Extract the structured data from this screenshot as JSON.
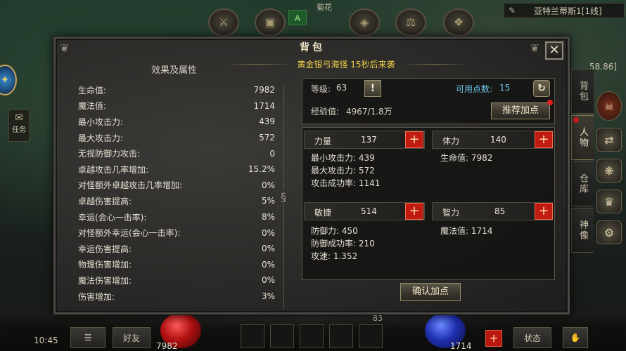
{
  "hud": {
    "top_label": "菊花",
    "top_badge": "A",
    "server_name": "亚特兰蒂斯1[1线]",
    "coord": "58.86]",
    "task_label": "任务",
    "time": "10:45",
    "friend_label": "好友",
    "hp_number": "7982",
    "mp_number": "1714",
    "level_small": "83",
    "state_label": "状态"
  },
  "side_tabs": [
    {
      "label": "背包"
    },
    {
      "label": "人物"
    },
    {
      "label": "仓库"
    },
    {
      "label": "神像"
    }
  ],
  "panel": {
    "title": "背包",
    "banner": "黄金银弓海怪 15秒后来袭",
    "close": "✕",
    "attr_header": "效果及属性",
    "attributes": [
      {
        "label": "生命值:",
        "value": "7982"
      },
      {
        "label": "魔法值:",
        "value": "1714"
      },
      {
        "label": "最小攻击力:",
        "value": "439"
      },
      {
        "label": "最大攻击力:",
        "value": "572"
      },
      {
        "label": "无视防御力攻击:",
        "value": "0"
      },
      {
        "label": "卓越攻击几率增加:",
        "value": "15.2%"
      },
      {
        "label": "对怪额外卓越攻击几率增加:",
        "value": "0%"
      },
      {
        "label": "卓越伤害提高:",
        "value": "5%"
      },
      {
        "label": "幸运(会心一击率):",
        "value": "8%"
      },
      {
        "label": "对怪额外幸运(会心一击率):",
        "value": "0%"
      },
      {
        "label": "幸运伤害提高:",
        "value": "0%"
      },
      {
        "label": "物理伤害增加:",
        "value": "0%"
      },
      {
        "label": "魔法伤害增加:",
        "value": "0%"
      },
      {
        "label": "伤害增加:",
        "value": "3%"
      }
    ],
    "level_label": "等级:",
    "level_value": "63",
    "points_label": "可用点数:",
    "points_value": "15",
    "exp_label": "经验值:",
    "exp_value": "4967/1.8万",
    "recommend_btn": "推荐加点",
    "confirm_btn": "确认加点",
    "stats": {
      "str": {
        "name": "力量",
        "value": "137",
        "derived": [
          "最小攻击力: 439",
          "最大攻击力: 572",
          "攻击成功率: 1141"
        ]
      },
      "vit": {
        "name": "体力",
        "value": "140",
        "derived": [
          "生命值: 7982"
        ]
      },
      "agi": {
        "name": "敏捷",
        "value": "514",
        "derived": [
          "防御力: 450",
          "防御成功率: 210",
          "攻速: 1.352"
        ]
      },
      "ene": {
        "name": "智力",
        "value": "85",
        "derived": [
          "魔法值: 1714"
        ]
      }
    }
  }
}
